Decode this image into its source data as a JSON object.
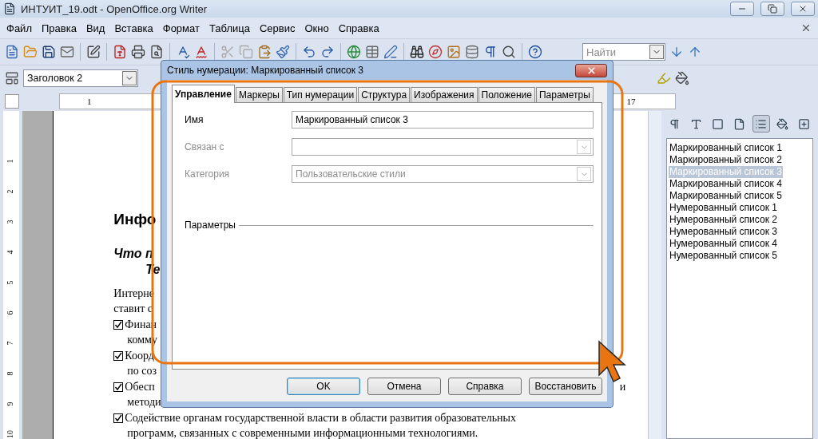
{
  "window": {
    "title": "ИНТУИТ_19.odt - OpenOffice.org Writer"
  },
  "menu": [
    {
      "label": "Файл"
    },
    {
      "label": "Правка"
    },
    {
      "label": "Вид"
    },
    {
      "label": "Вставка"
    },
    {
      "label": "Формат"
    },
    {
      "label": "Таблица"
    },
    {
      "label": "Сервис"
    },
    {
      "label": "Окно"
    },
    {
      "label": "Справка"
    }
  ],
  "style_box": {
    "value": "Заголовок 2"
  },
  "search": {
    "placeholder": "Найти"
  },
  "ruler": {
    "labels": [
      "1",
      "17"
    ]
  },
  "vertical_ruler": {
    "labels": [
      "1",
      "2",
      "3",
      "4",
      "5",
      "6",
      "7",
      "8",
      "9",
      "10"
    ]
  },
  "document": {
    "heading": "Инфо",
    "subheading": [
      "Что п",
      "Те"
    ],
    "lines": [
      {
        "text": "Интерне",
        "check": false,
        "indent": false
      },
      {
        "text": "ставит с",
        "check": false,
        "indent": false
      },
      {
        "text": "Финан",
        "check": true,
        "indent": false
      },
      {
        "text": "комму",
        "check": false,
        "indent": true
      },
      {
        "text": "Коорд",
        "check": true,
        "indent": false
      },
      {
        "text": "по соз",
        "check": false,
        "indent": true
      },
      {
        "text": "Обесп",
        "check": true,
        "indent": false,
        "tail": "и"
      },
      {
        "text": "методи",
        "check": false,
        "indent": true
      }
    ],
    "full_lines": [
      {
        "text": "Содействие органам государственной власти в области развития образовательных",
        "check": true,
        "indent": false
      },
      {
        "text": "программ, связанных с современными информационными технологиями.",
        "check": false,
        "indent": true
      }
    ]
  },
  "dialog": {
    "title": "Стиль нумерации: Маркированный список 3",
    "tabs": [
      {
        "label": "Управление",
        "selected": true
      },
      {
        "label": "Маркеры",
        "selected": false
      },
      {
        "label": "Тип нумерации",
        "selected": false
      },
      {
        "label": "Структура",
        "selected": false
      },
      {
        "label": "Изображения",
        "selected": false
      },
      {
        "label": "Положение",
        "selected": false
      },
      {
        "label": "Параметры",
        "selected": false
      }
    ],
    "fields": [
      {
        "label": "Имя",
        "kind": "text",
        "value": "Маркированный список 3",
        "disabled": false
      },
      {
        "label": "Связан с",
        "kind": "combo",
        "disabled": true
      },
      {
        "label": "Категория",
        "kind": "combo",
        "value": "Пользовательские стили",
        "disabled": true
      }
    ],
    "section": "Параметры",
    "buttons": [
      {
        "label": "OK",
        "default": true
      },
      {
        "label": "Отмена",
        "default": false
      },
      {
        "label": "Справка",
        "default": false
      },
      {
        "label": "Восстановить",
        "default": false
      }
    ]
  },
  "sidebar": {
    "list": [
      {
        "label": "Маркированный список 1",
        "selected": false
      },
      {
        "label": "Маркированный список 2",
        "selected": false
      },
      {
        "label": "Маркированный список 3",
        "selected": true
      },
      {
        "label": "Маркированный список 4",
        "selected": false
      },
      {
        "label": "Маркированный список 5",
        "selected": false
      },
      {
        "label": "Нумерованный список 1",
        "selected": false
      },
      {
        "label": "Нумерованный список 2",
        "selected": false
      },
      {
        "label": "Нумерованный список 3",
        "selected": false
      },
      {
        "label": "Нумерованный список 4",
        "selected": false
      },
      {
        "label": "Нумерованный список 5",
        "selected": false
      }
    ]
  }
}
